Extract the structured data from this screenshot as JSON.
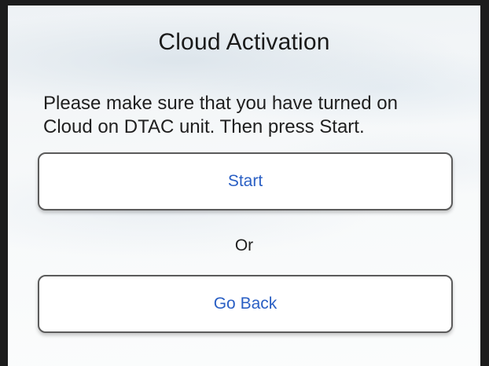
{
  "dialog": {
    "title": "Cloud Activation",
    "message": "Please make sure that you have turned on Cloud on DTAC unit. Then press Start.",
    "start_label": "Start",
    "separator": "Or",
    "back_label": "Go Back"
  },
  "colors": {
    "button_text": "#2a5fc4",
    "button_border": "#5b5b5b",
    "frame": "#1c1c1c"
  }
}
